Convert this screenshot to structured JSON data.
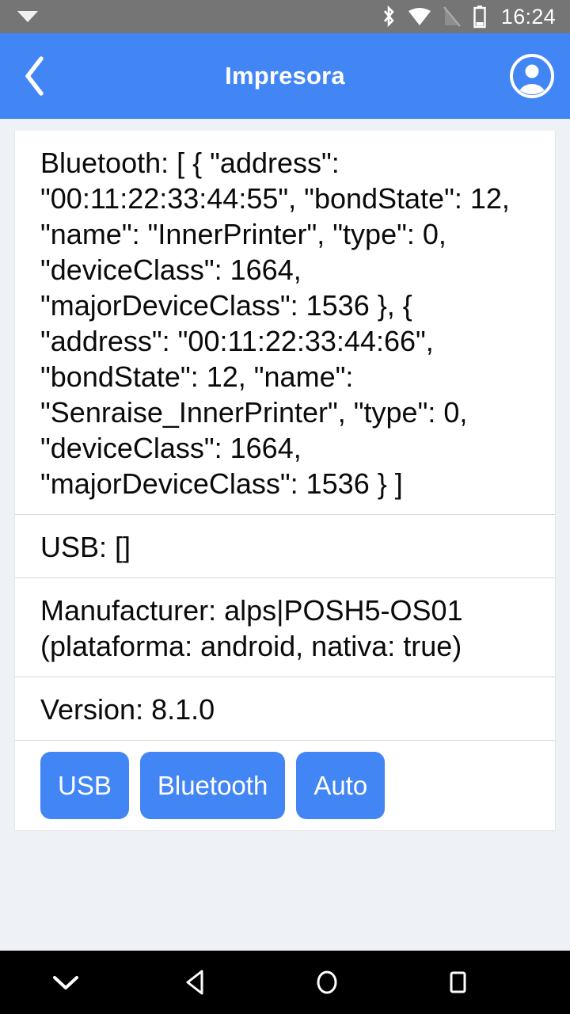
{
  "status_bar": {
    "notification_icon": "caret-down-icon",
    "icons": [
      "bluetooth-icon",
      "wifi-icon",
      "signal-off-icon",
      "battery-icon"
    ],
    "clock": "16:24",
    "background_color": "#757575"
  },
  "app_bar": {
    "back_icon": "chevron-left-icon",
    "title": "Impresora",
    "account_icon": "account-circle-icon",
    "background_color": "#4285f4"
  },
  "card": {
    "sections": [
      {
        "name": "bluetooth",
        "text": "Bluetooth: [ { \"address\": \"00:11:22:33:44:55\", \"bondState\": 12, \"name\": \"InnerPrinter\", \"type\": 0, \"deviceClass\": 1664, \"majorDeviceClass\": 1536 }, { \"address\": \"00:11:22:33:44:66\", \"bondState\": 12, \"name\": \"Senraise_InnerPrinter\", \"type\": 0, \"deviceClass\": 1664, \"majorDeviceClass\": 1536 } ]"
      },
      {
        "name": "usb",
        "text": "USB: []"
      },
      {
        "name": "manufacturer",
        "text": "Manufacturer: alps|POSH5-OS01 (plataforma: android, nativa: true)"
      },
      {
        "name": "version",
        "text": "Version: 8.1.0"
      }
    ]
  },
  "buttons": {
    "usb": "USB",
    "bluetooth": "Bluetooth",
    "auto": "Auto",
    "color": "#4285f4"
  },
  "nav_bar": {
    "hide_keyboard_icon": "chevron-down-icon",
    "back_icon": "triangle-back-icon",
    "home_icon": "circle-home-icon",
    "recents_icon": "square-recents-icon",
    "background_color": "#000000"
  }
}
